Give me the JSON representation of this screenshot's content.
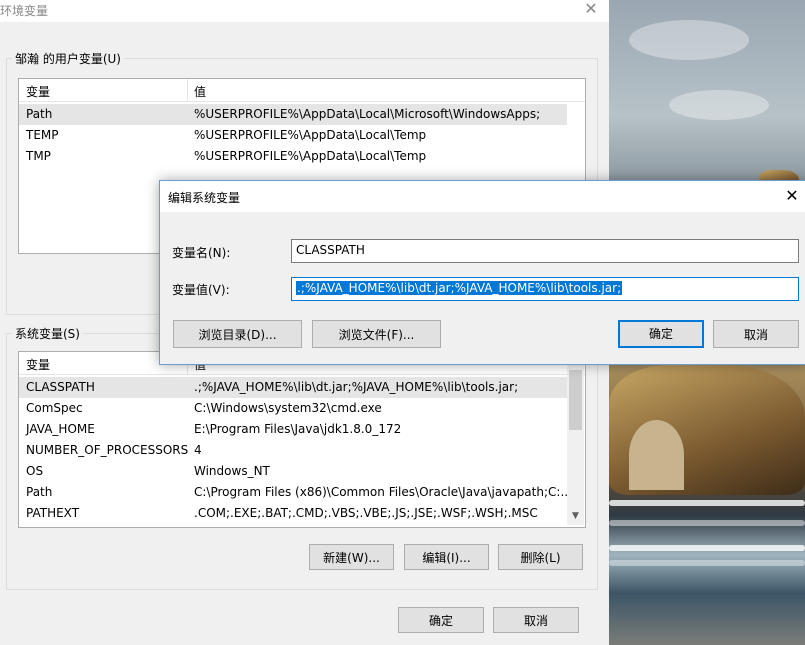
{
  "window": {
    "title": "环境变量",
    "close_glyph": "✕"
  },
  "user_vars": {
    "group_label": "邹瀚 的用户变量(U)",
    "headers": {
      "name": "变量",
      "value": "值"
    },
    "rows": [
      {
        "name": "Path",
        "value": "%USERPROFILE%\\AppData\\Local\\Microsoft\\WindowsApps;"
      },
      {
        "name": "TEMP",
        "value": "%USERPROFILE%\\AppData\\Local\\Temp"
      },
      {
        "name": "TMP",
        "value": "%USERPROFILE%\\AppData\\Local\\Temp"
      }
    ]
  },
  "system_vars": {
    "group_label": "系统变量(S)",
    "headers": {
      "name": "变量",
      "value": "值"
    },
    "rows": [
      {
        "name": "CLASSPATH",
        "value": ".;%JAVA_HOME%\\lib\\dt.jar;%JAVA_HOME%\\lib\\tools.jar;"
      },
      {
        "name": "ComSpec",
        "value": "C:\\Windows\\system32\\cmd.exe"
      },
      {
        "name": "JAVA_HOME",
        "value": "E:\\Program Files\\Java\\jdk1.8.0_172"
      },
      {
        "name": "NUMBER_OF_PROCESSORS",
        "value": "4"
      },
      {
        "name": "OS",
        "value": "Windows_NT"
      },
      {
        "name": "Path",
        "value": "C:\\Program Files (x86)\\Common Files\\Oracle\\Java\\javapath;C:..."
      },
      {
        "name": "PATHEXT",
        "value": ".COM;.EXE;.BAT;.CMD;.VBS;.VBE;.JS;.JSE;.WSF;.WSH;.MSC"
      }
    ],
    "buttons": {
      "new": "新建(W)...",
      "edit": "编辑(I)...",
      "delete": "删除(L)"
    }
  },
  "footer": {
    "ok": "确定",
    "cancel": "取消"
  },
  "edit_dialog": {
    "title": "编辑系统变量",
    "close_glyph": "✕",
    "name_label": "变量名(N):",
    "name_value": "CLASSPATH",
    "value_label": "变量值(V):",
    "value_value": ".;%JAVA_HOME%\\lib\\dt.jar;%JAVA_HOME%\\lib\\tools.jar;",
    "browse_dir": "浏览目录(D)...",
    "browse_file": "浏览文件(F)...",
    "ok": "确定",
    "cancel": "取消"
  },
  "colors": {
    "accent": "#0078d7",
    "selection_bg": "#e5e5e5",
    "dialog_border": "#6c9ad2"
  },
  "icons": {
    "close": "close-icon",
    "scroll_down": "chevron-down-icon"
  }
}
